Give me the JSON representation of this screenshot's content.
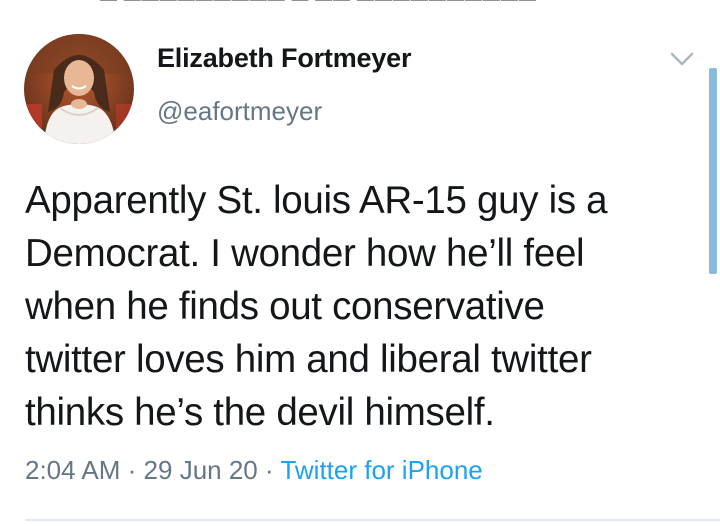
{
  "tweet": {
    "author": {
      "display_name": "Elizabeth Fortmeyer",
      "handle": "@eafortmeyer",
      "avatar_icon": "profile-photo"
    },
    "text_lines": [
      "Apparently St. louis AR-15 guy is a",
      "Democrat. I wonder how he’ll feel",
      "when he finds out conservative",
      "twitter loves him and liberal twitter",
      "thinks he’s the devil himself."
    ],
    "time": "2:04 AM",
    "date": "29 Jun 20",
    "separator": "·",
    "source": "Twitter for iPhone",
    "menu_icon": "chevron-down-icon"
  },
  "colors": {
    "text_primary": "#14171a",
    "text_secondary": "#657786",
    "link": "#1da1f2",
    "scrollbar": "#89b9dc",
    "divider": "#e1e8ed"
  }
}
